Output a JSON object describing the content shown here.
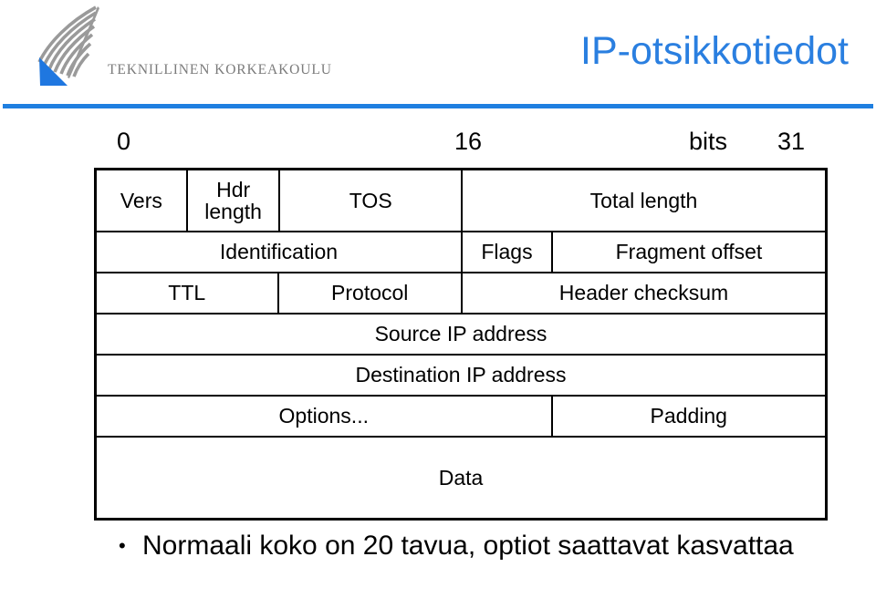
{
  "slide": {
    "title": "IP-otsikkotiedot",
    "title_color": "#2a7fe0",
    "rule_color": "#1f7fe0"
  },
  "logo": {
    "wordmark": "TEKNILLINEN KORKEAKOULU",
    "feather_color": "#9a9a9a",
    "triangle_color": "#1f77e0"
  },
  "bit_ruler": {
    "start": "0",
    "middle": "16",
    "units": "bits",
    "end": "31"
  },
  "ip_header": {
    "rows": [
      {
        "name": "row-version",
        "cells": [
          {
            "label": "Vers",
            "width_pct": 12.5
          },
          {
            "label": "Hdr length",
            "width_pct": 12.75,
            "two_line": true
          },
          {
            "label": "TOS",
            "width_pct": 25.0
          },
          {
            "label": "Total length",
            "width_pct": 49.75
          }
        ]
      },
      {
        "name": "row-identification",
        "cells": [
          {
            "label": "Identification",
            "width_pct": 50.25
          },
          {
            "label": "Flags",
            "width_pct": 12.4
          },
          {
            "label": "Fragment offset",
            "width_pct": 37.35
          }
        ]
      },
      {
        "name": "row-ttl",
        "cells": [
          {
            "label": "TTL",
            "width_pct": 25.0
          },
          {
            "label": "Protocol",
            "width_pct": 25.25
          },
          {
            "label": "Header checksum",
            "width_pct": 49.75
          }
        ]
      },
      {
        "name": "row-source-address",
        "cells": [
          {
            "label": "Source IP address",
            "width_pct": 100
          }
        ]
      },
      {
        "name": "row-destination-address",
        "cells": [
          {
            "label": "Destination IP address",
            "width_pct": 100
          }
        ]
      },
      {
        "name": "row-options",
        "cells": [
          {
            "label": "Options...",
            "width_pct": 62.6
          },
          {
            "label": "Padding",
            "width_pct": 37.4
          }
        ]
      },
      {
        "name": "row-data",
        "cells": [
          {
            "label": "Data",
            "width_pct": 100
          }
        ]
      }
    ]
  },
  "bullets": [
    {
      "marker": "•",
      "text": "Normaali koko on 20 tavua, optiot saattavat kasvattaa"
    }
  ]
}
